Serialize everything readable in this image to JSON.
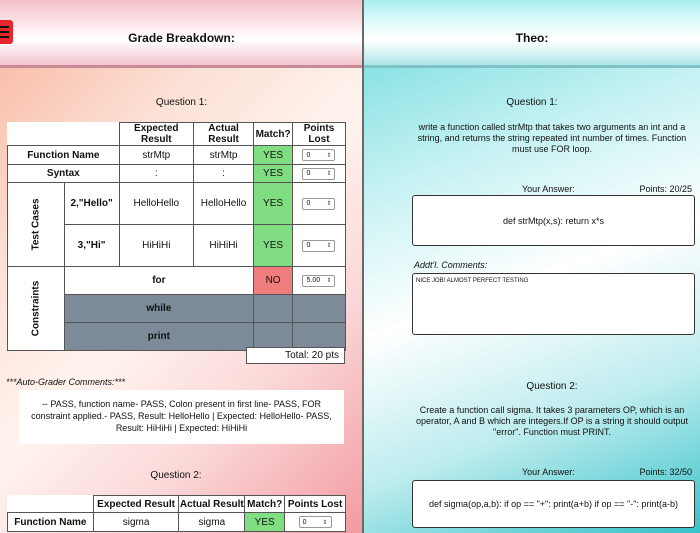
{
  "left": {
    "title": "Grade Breakdown:",
    "q1": {
      "title": "Question 1:",
      "headers": [
        "Expected Result",
        "Actual Result",
        "Match?",
        "Points Lost"
      ],
      "rows": [
        {
          "label": "Function Name",
          "expected": "strMtp",
          "actual": "strMtp",
          "match": "YES",
          "points": "0"
        },
        {
          "label": "Syntax",
          "expected": ":",
          "actual": ":",
          "match": "YES",
          "points": "0"
        }
      ],
      "test_cases_label": "Test Cases",
      "test_cases": [
        {
          "input": "2,\"Hello\"",
          "expected": "HelloHello",
          "actual": "HelloHello",
          "match": "YES",
          "points": "0"
        },
        {
          "input": "3,\"Hi\"",
          "expected": "HiHiHi",
          "actual": "HiHiHi",
          "match": "YES",
          "points": "0"
        }
      ],
      "constraints_label": "Constraints",
      "constraints": [
        {
          "label": "for",
          "match": "NO",
          "points": "5.00"
        },
        {
          "label": "while"
        },
        {
          "label": "print"
        }
      ],
      "total": "Total: 20 pts"
    },
    "auto_grader_label": "***Auto-Grader Comments:***",
    "auto_grader_text": "-- PASS, function name- PASS, Colon present in first line- PASS, FOR constraint applied.- PASS, Result: HelloHello | Expected: HelloHello- PASS, Result: HiHiHi | Expected: HiHiHi",
    "q2": {
      "title": "Question 2:",
      "headers": [
        "Expected Result",
        "Actual Result",
        "Match?",
        "Points Lost"
      ],
      "rows": [
        {
          "label": "Function Name",
          "expected": "sigma",
          "actual": "sigma",
          "match": "YES",
          "points": "0"
        }
      ]
    }
  },
  "right": {
    "title": "Theo:",
    "q1": {
      "title": "Question 1:",
      "prompt": "write a function called strMtp that takes two arguments an int and a string, and returns the string repeated int number of times. Function must use FOR loop.",
      "answer_label": "Your Answer:",
      "points": "Points: 20/25",
      "answer": "def strMtp(x,s): return x*s",
      "comments_label": "Addt'l. Comments:",
      "comments": "NICE JOB! ALMOST PERFECT TESTING"
    },
    "q2": {
      "title": "Question 2:",
      "prompt": "Create a function call sigma. It takes 3 parameters OP, which is an operator, A and B which are integers.If OP is a string it should output \"error\". Function must PRINT.",
      "answer_label": "Your Answer:",
      "points": "Points: 32/50",
      "answer": "def sigma(op,a,b): if op == \"+\": print(a+b) if op == \"-\": print(a-b)"
    }
  },
  "colors": {
    "yes": "#80dd82",
    "no": "#ef7d7b",
    "disabled": "#7d8b99",
    "menu": "#e5262d"
  }
}
